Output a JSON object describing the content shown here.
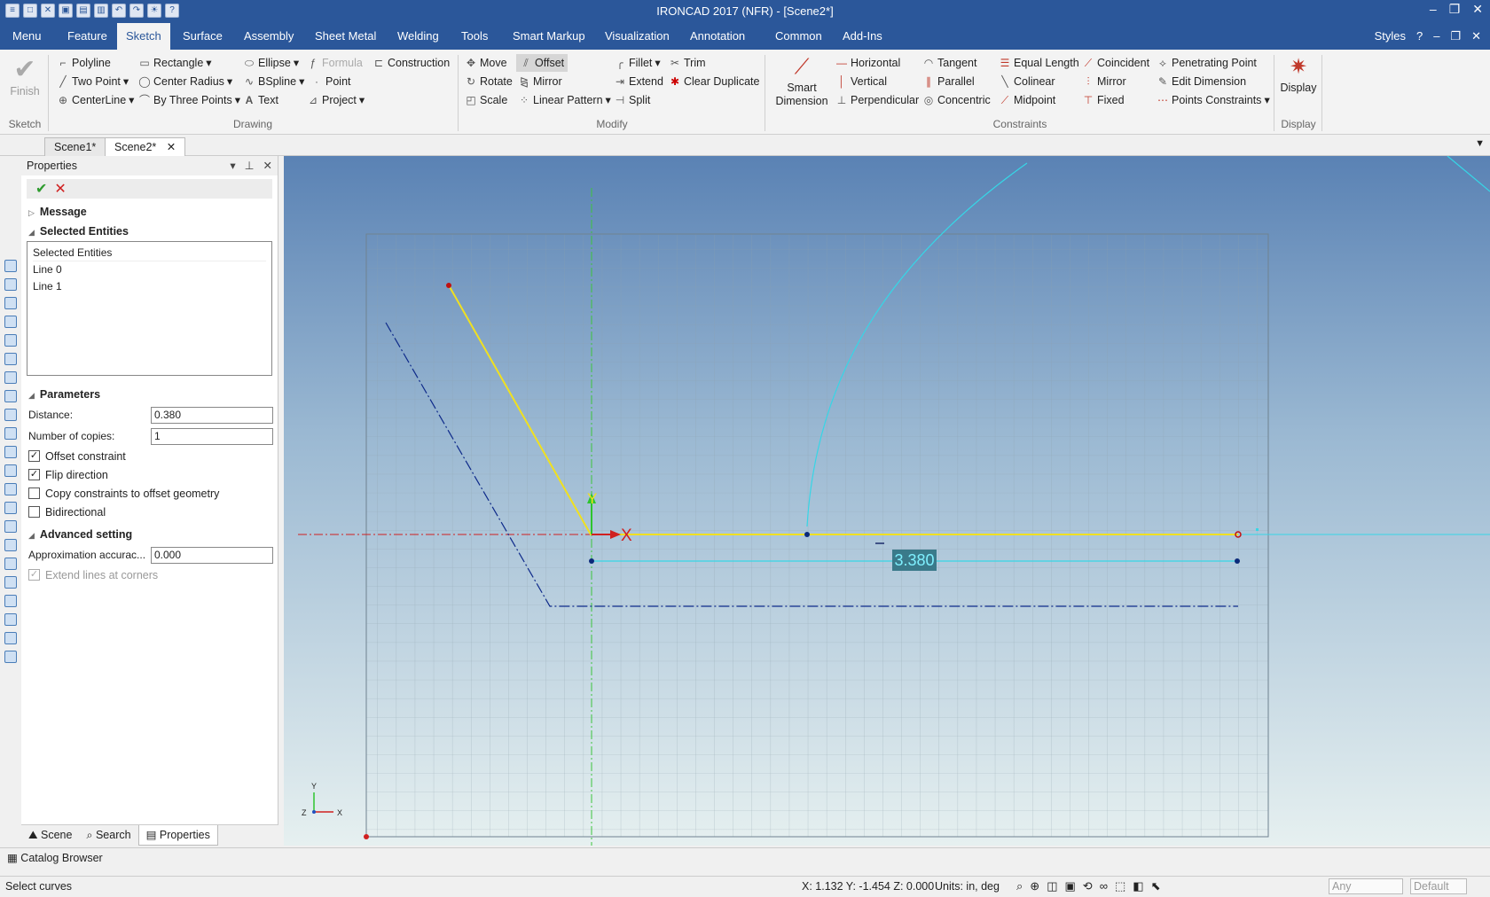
{
  "app": {
    "title": "IRONCAD 2017 (NFR) - [Scene2*]"
  },
  "menu": {
    "tabs": [
      "Menu",
      "Feature",
      "Sketch",
      "Surface",
      "Assembly",
      "Sheet Metal",
      "Welding",
      "Tools",
      "Smart Markup",
      "Visualization",
      "Annotation",
      "Common",
      "Add-Ins"
    ],
    "styles": "Styles"
  },
  "ribbon": {
    "finish": "Finish",
    "drawing": {
      "polyline": "Polyline",
      "rectangle": "Rectangle",
      "ellipse": "Ellipse",
      "formula": "Formula",
      "construction": "Construction",
      "two_point": "Two Point",
      "center_radius": "Center Radius",
      "bspline": "BSpline",
      "point": "Point",
      "centerline": "CenterLine",
      "by_three_points": "By Three Points",
      "text": "Text",
      "project": "Project"
    },
    "modify": {
      "move": "Move",
      "offset": "Offset",
      "fillet": "Fillet",
      "trim": "Trim",
      "rotate": "Rotate",
      "mirror": "Mirror",
      "extend": "Extend",
      "clear_duplicate": "Clear Duplicate",
      "scale": "Scale",
      "linear_pattern": "Linear Pattern",
      "split": "Split"
    },
    "smart_dimension": {
      "line1": "Smart",
      "line2": "Dimension"
    },
    "constraints": {
      "horizontal": "Horizontal",
      "tangent": "Tangent",
      "equal_length": "Equal Length",
      "coincident": "Coincident",
      "penetrating_point": "Penetrating Point",
      "vertical": "Vertical",
      "parallel": "Parallel",
      "colinear": "Colinear",
      "mirror": "Mirror",
      "edit_dimension": "Edit Dimension",
      "perpendicular": "Perpendicular",
      "concentric": "Concentric",
      "midpoint": "Midpoint",
      "fixed": "Fixed",
      "points_constraints": "Points Constraints"
    },
    "display": "Display",
    "groups": {
      "sketch": "Sketch",
      "drawing": "Drawing",
      "modify": "Modify",
      "constraints": "Constraints",
      "display": "Display"
    }
  },
  "doc_tabs": [
    "Scene1*",
    "Scene2*"
  ],
  "properties": {
    "header": "Properties",
    "message": "Message",
    "selected_entities": {
      "title": "Selected Entities",
      "col": "Selected Entities",
      "items": [
        "Line 0",
        "Line 1"
      ]
    },
    "parameters": {
      "title": "Parameters",
      "distance_label": "Distance:",
      "distance": "0.380",
      "copies_label": "Number of copies:",
      "copies": "1"
    },
    "checks": [
      {
        "label": "Offset constraint",
        "checked": true
      },
      {
        "label": "Flip direction",
        "checked": true
      },
      {
        "label": "Copy constraints to offset geometry",
        "checked": false
      },
      {
        "label": "Bidirectional",
        "checked": false
      }
    ],
    "advanced": {
      "title": "Advanced setting",
      "approx_label": "Approximation accurac...",
      "approx": "0.000",
      "extend_label": "Extend lines at corners"
    }
  },
  "bottom_tabs": [
    "Scene",
    "Search",
    "Properties"
  ],
  "catalog": "Catalog Browser",
  "viewport": {
    "dimension": "3.380",
    "axis_x": "X",
    "axis_y": "Y",
    "axis_z": "Z"
  },
  "status": {
    "left": "Select curves",
    "coords": "X: 1.132 Y: -1.454 Z: 0.000",
    "units": "Units: in, deg",
    "any": "Any",
    "default": "Default"
  }
}
